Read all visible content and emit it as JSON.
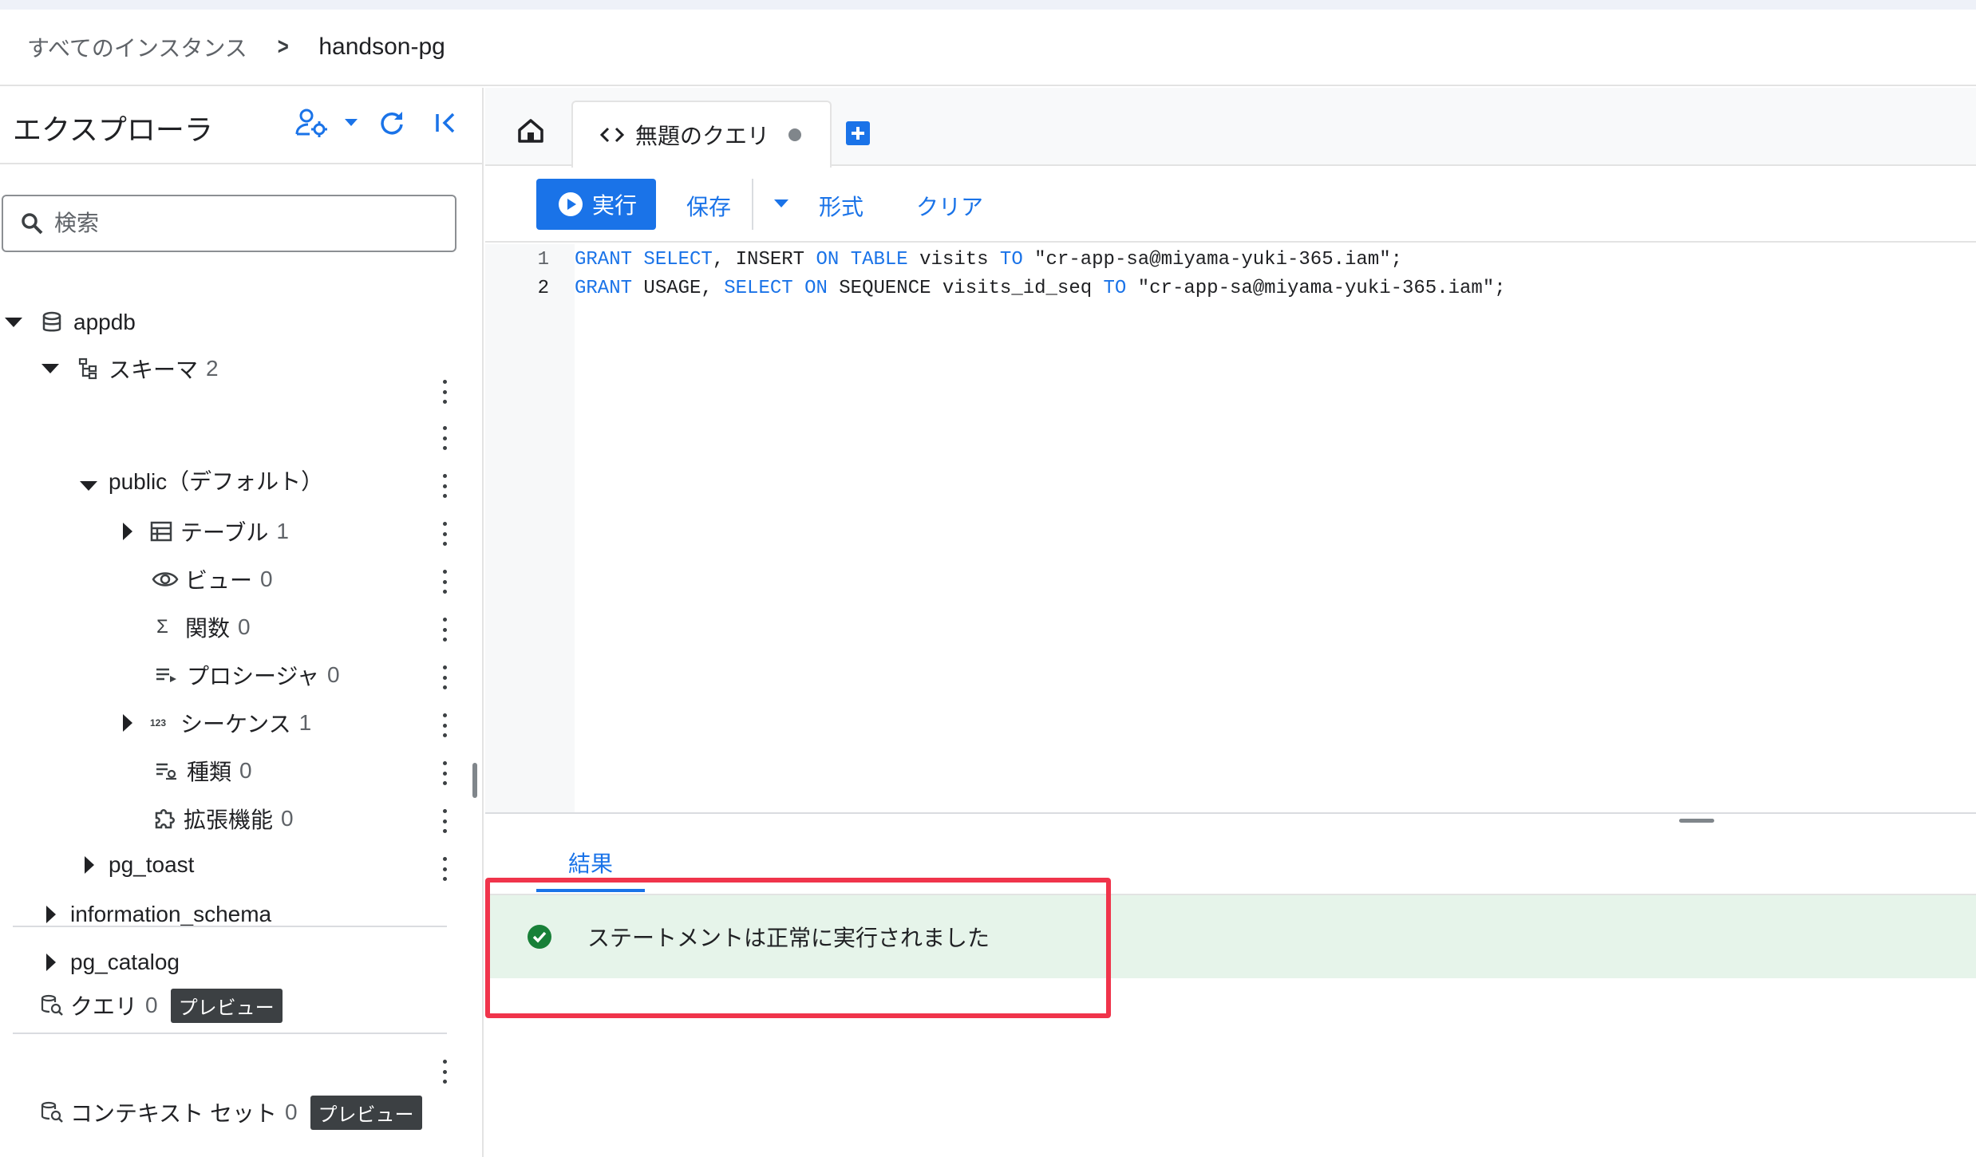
{
  "breadcrumb": {
    "all_instances": "すべてのインスタンス",
    "separator": ">",
    "current": "handson-pg"
  },
  "explorer": {
    "title": "エクスプローラ",
    "search_placeholder": "検索",
    "tree": {
      "appdb": "appdb",
      "schemas_label": "スキーマ",
      "schemas_count": "2",
      "public": "public（デフォルト）",
      "tables_label": "テーブル",
      "tables_count": "1",
      "views_label": "ビュー",
      "views_count": "0",
      "functions_label": "関数",
      "functions_count": "0",
      "procedures_label": "プロシージャ",
      "procedures_count": "0",
      "sequences_label": "シーケンス",
      "sequences_count": "1",
      "types_label": "種類",
      "types_count": "0",
      "extensions_label": "拡張機能",
      "extensions_count": "0",
      "pg_toast": "pg_toast",
      "information_schema": "information_schema",
      "pg_catalog": "pg_catalog"
    },
    "queries": {
      "label": "クエリ",
      "count": "0",
      "badge": "プレビュー"
    },
    "context_sets": {
      "label": "コンテキスト セット",
      "count": "0",
      "badge": "プレビュー"
    }
  },
  "tabs": {
    "query_tab_label": "無題のクエリ"
  },
  "toolbar": {
    "run": "実行",
    "save": "保存",
    "format": "形式",
    "clear": "クリア"
  },
  "editor": {
    "lines": [
      {
        "number": "1",
        "tokens": [
          {
            "t": "GRANT",
            "k": "kw"
          },
          {
            "t": " "
          },
          {
            "t": "SELECT",
            "k": "kw"
          },
          {
            "t": ", INSERT "
          },
          {
            "t": "ON",
            "k": "kw"
          },
          {
            "t": " "
          },
          {
            "t": "TABLE",
            "k": "kw"
          },
          {
            "t": " visits "
          },
          {
            "t": "TO",
            "k": "kw"
          },
          {
            "t": " \"cr-app-sa@miyama-yuki-365.iam\";"
          }
        ]
      },
      {
        "number": "2",
        "tokens": [
          {
            "t": "GRANT",
            "k": "kw"
          },
          {
            "t": " USAGE, "
          },
          {
            "t": "SELECT",
            "k": "kw"
          },
          {
            "t": " "
          },
          {
            "t": "ON",
            "k": "kw"
          },
          {
            "t": " SEQUENCE visits_id_seq "
          },
          {
            "t": "TO",
            "k": "kw"
          },
          {
            "t": " \"cr-app-sa@miyama-yuki-365.iam\";"
          }
        ]
      }
    ]
  },
  "results": {
    "tab_label": "結果",
    "message": "ステートメントは正常に実行されました"
  },
  "colors": {
    "accent": "#1a73e8",
    "success_bg": "#e6f4ea",
    "success_icon": "#188038",
    "highlight_border": "#f0344b"
  }
}
